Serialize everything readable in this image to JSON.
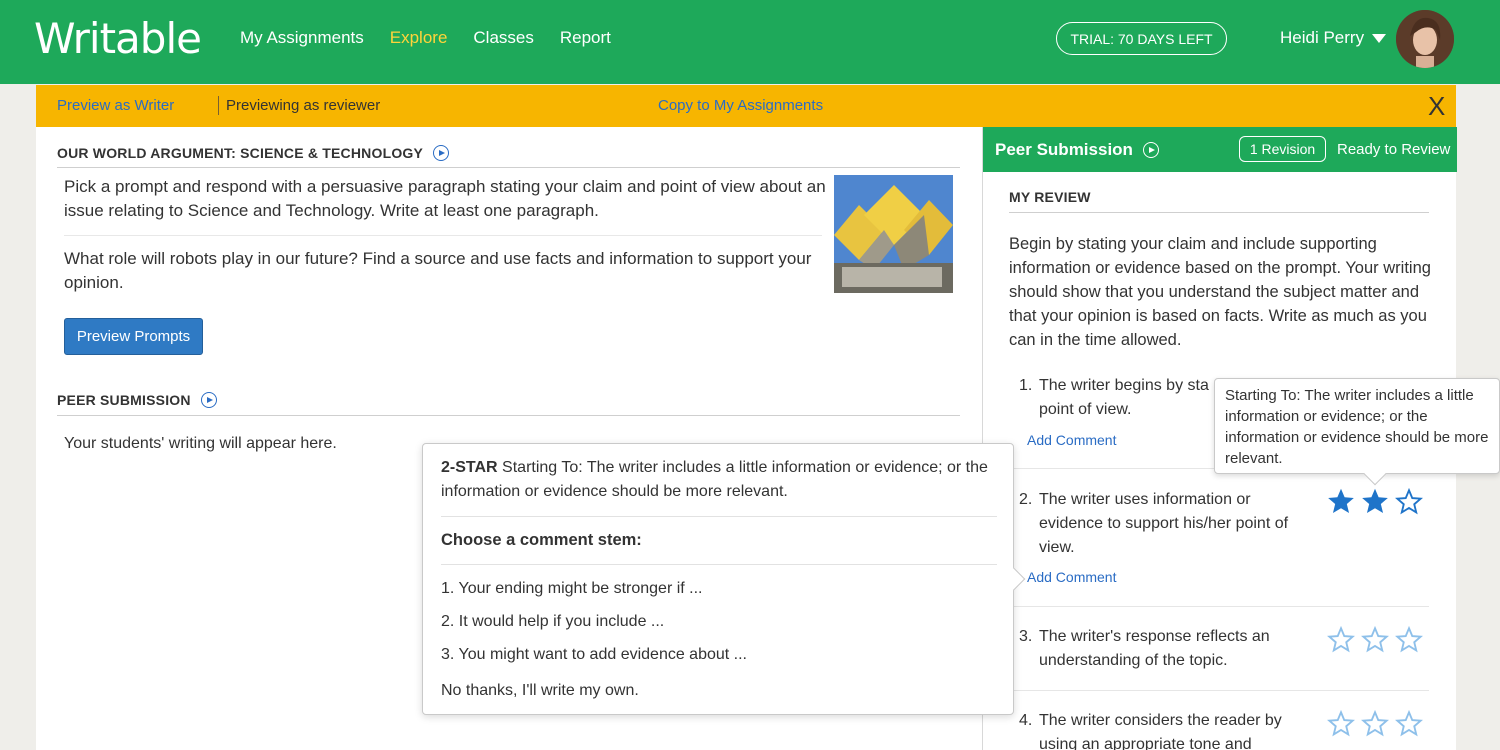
{
  "app": {
    "logo": "Writable"
  },
  "nav": {
    "items": [
      {
        "label": "My Assignments",
        "active": false
      },
      {
        "label": "Explore",
        "active": true
      },
      {
        "label": "Classes",
        "active": false
      },
      {
        "label": "Report",
        "active": false
      }
    ],
    "trial": "TRIAL: 70 DAYS LEFT",
    "user_name": "Heidi Perry"
  },
  "preview_bar": {
    "preview_writer": "Preview as Writer",
    "previewing": "Previewing as reviewer",
    "copy": "Copy to My Assignments",
    "close": "X"
  },
  "assignment": {
    "title": "OUR WORLD ARGUMENT: SCIENCE & TECHNOLOGY",
    "intro": "Pick a prompt and respond with a persuasive paragraph stating your claim and point of view about an issue relating to Science and Technology. Write at least one paragraph.",
    "prompt": "What role will robots play in our future? Find a source and use facts and information to support your opinion.",
    "preview_button": "Preview Prompts",
    "peer_title": "PEER SUBMISSION",
    "peer_placeholder": "Your students' writing will appear here."
  },
  "popover": {
    "level": "2-STAR",
    "description": "Starting To: The writer includes a little information or evidence; or the information or evidence should be more relevant.",
    "stem_heading": "Choose a comment stem:",
    "stems": [
      "1. Your ending might be stronger if ...",
      "2. It would help if you include ...",
      "3. You might want to add evidence about ..."
    ],
    "own": "No thanks, I'll write my own."
  },
  "review": {
    "header": "Peer Submission",
    "revision": "1 Revision",
    "status": "Ready to Review",
    "section": "MY REVIEW",
    "instructions": "Begin by stating your claim and include supporting information or evidence based on the prompt. Your writing should show that you understand the subject matter and that your opinion is based on facts. Write as much as you can in the time allowed.",
    "criteria": [
      {
        "num": "1.",
        "line1": "The writer begins by sta",
        "line2": "point of view.",
        "add": "Add Comment",
        "rating": 0
      },
      {
        "num": "2.",
        "line1": "The writer uses information or",
        "line2": "evidence to support his/her point of",
        "line3": "view.",
        "add": "Add Comment",
        "rating": 2
      },
      {
        "num": "3.",
        "line1": "The writer's response reflects an",
        "line2": "understanding of the topic.",
        "rating": 0
      },
      {
        "num": "4.",
        "line1": "The writer considers the reader by",
        "line2": "using an appropriate tone and",
        "rating": 0
      }
    ],
    "tooltip": "Starting To: The writer includes a little information or evidence; or the information or evidence should be more relevant."
  },
  "colors": {
    "brand_green": "#1ea95a",
    "bar_yellow": "#f7b500",
    "link_blue": "#2a6cc4",
    "star_blue": "#1f74c9"
  }
}
